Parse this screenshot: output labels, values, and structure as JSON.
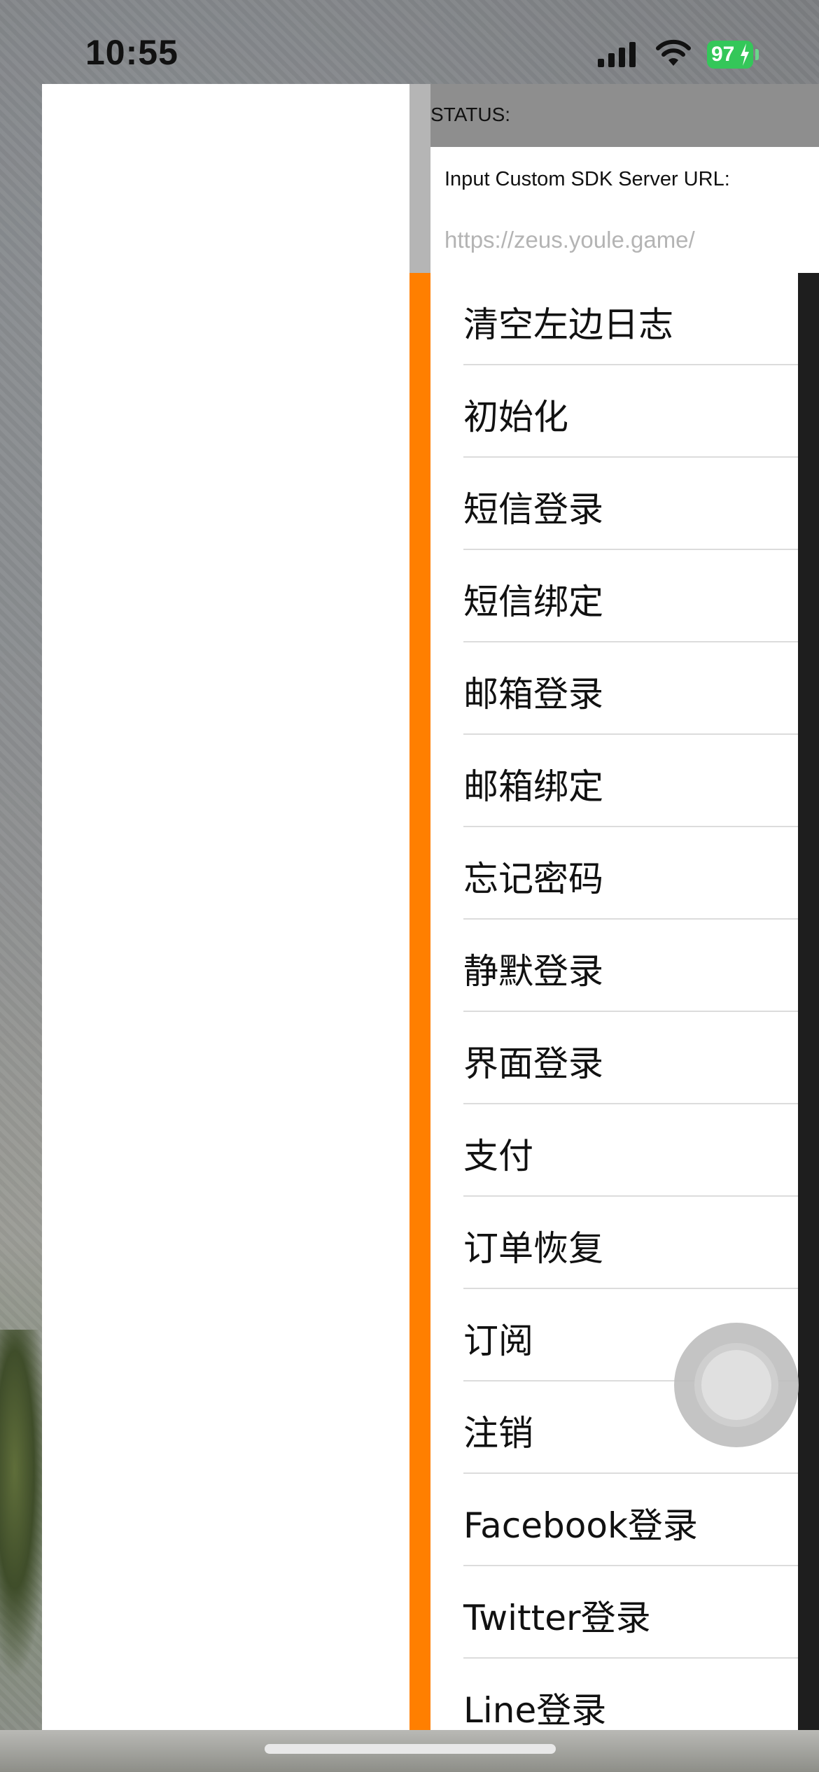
{
  "status_bar": {
    "time": "10:55",
    "battery": "97"
  },
  "panel": {
    "status_label": "STATUS:",
    "url_label": "Input Custom SDK Server URL:",
    "url_placeholder": "https://zeus.youle.game/"
  },
  "menu": {
    "items": [
      {
        "label": "清空左边日志"
      },
      {
        "label": "初始化"
      },
      {
        "label": "短信登录"
      },
      {
        "label": "短信绑定"
      },
      {
        "label": "邮箱登录"
      },
      {
        "label": "邮箱绑定"
      },
      {
        "label": "忘记密码"
      },
      {
        "label": "静默登录"
      },
      {
        "label": "界面登录"
      },
      {
        "label": "支付"
      },
      {
        "label": "订单恢复"
      },
      {
        "label": "订阅"
      },
      {
        "label": "注销"
      },
      {
        "label": "Facebook登录"
      },
      {
        "label": "Twitter登录"
      },
      {
        "label": "Line登录"
      }
    ]
  },
  "colors": {
    "accent": "#ff7f00",
    "battery": "#34c759",
    "status_header_bg": "#8e8e8e"
  },
  "icons": {
    "signal": "cellular-signal-icon",
    "wifi": "wifi-icon",
    "battery": "battery-icon",
    "assistive": "assistive-touch-icon"
  }
}
